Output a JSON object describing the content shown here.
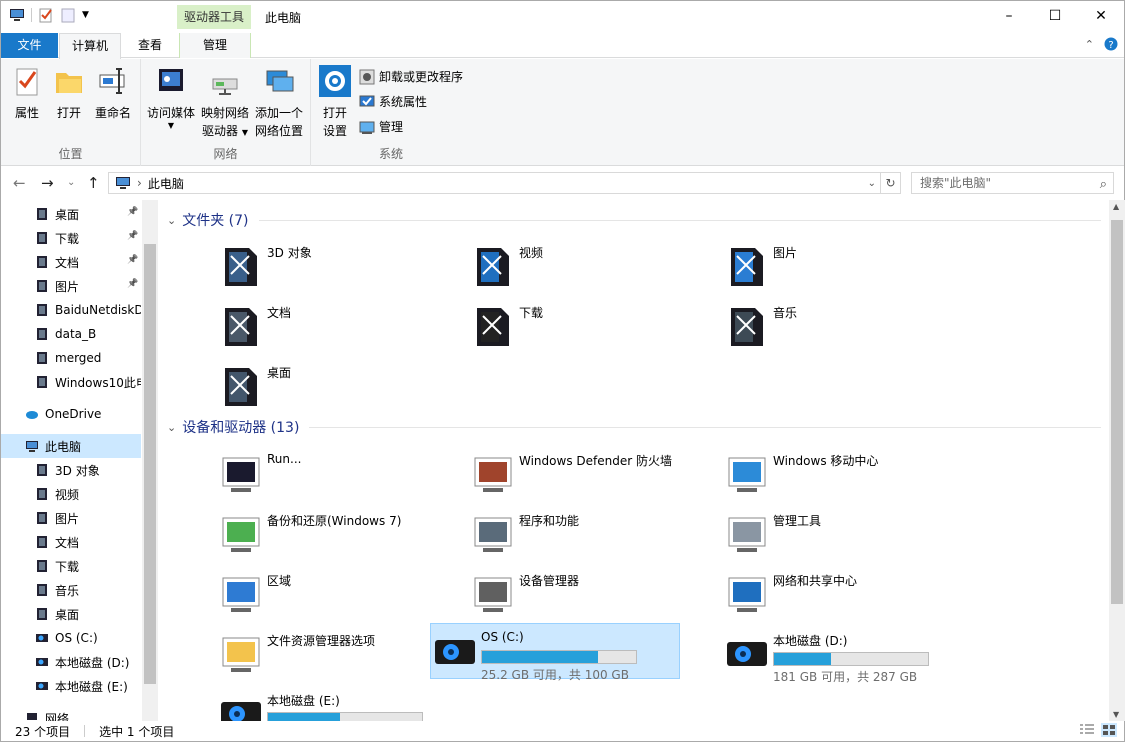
{
  "window": {
    "title": "此电脑",
    "context_tab": "驱动器工具",
    "controls": [
      "–",
      "☐",
      "✕"
    ]
  },
  "tabs": {
    "file": "文件",
    "computer": "计算机",
    "view": "查看",
    "manage": "管理"
  },
  "ribbon": {
    "location": {
      "label": "位置",
      "properties": "属性",
      "open": "打开",
      "rename": "重命名"
    },
    "network": {
      "label": "网络",
      "media": "访问媒体",
      "map_drive_1": "映射网络",
      "map_drive_2": "驱动器",
      "add_loc_1": "添加一个",
      "add_loc_2": "网络位置"
    },
    "system": {
      "label": "系统",
      "open_settings_1": "打开",
      "open_settings_2": "设置",
      "uninstall": "卸载或更改程序",
      "sys_props": "系统属性",
      "manage": "管理"
    }
  },
  "address": {
    "path": "此电脑",
    "search_placeholder": "搜索\"此电脑\""
  },
  "nav": {
    "items": [
      {
        "label": "桌面",
        "pinned": true
      },
      {
        "label": "下载",
        "pinned": true
      },
      {
        "label": "文档",
        "pinned": true
      },
      {
        "label": "图片",
        "pinned": true
      },
      {
        "label": "BaiduNetdiskD"
      },
      {
        "label": "data_B"
      },
      {
        "label": "merged"
      },
      {
        "label": "Windows10此电"
      },
      {
        "label": "OneDrive"
      },
      {
        "label": "此电脑"
      },
      {
        "label": "3D 对象"
      },
      {
        "label": "视频"
      },
      {
        "label": "图片"
      },
      {
        "label": "文档"
      },
      {
        "label": "下载"
      },
      {
        "label": "音乐"
      },
      {
        "label": "桌面"
      },
      {
        "label": "OS (C:)"
      },
      {
        "label": "本地磁盘 (D:)"
      },
      {
        "label": "本地磁盘 (E:)"
      },
      {
        "label": "网络"
      }
    ]
  },
  "folders": {
    "header": "文件夹 (7)",
    "items": [
      "3D 对象",
      "视频",
      "图片",
      "文档",
      "下载",
      "音乐",
      "桌面"
    ]
  },
  "devices": {
    "header": "设备和驱动器 (13)",
    "items": [
      "Run...",
      "Windows Defender 防火墙",
      "Windows 移动中心",
      "备份和还原(Windows 7)",
      "程序和功能",
      "管理工具",
      "区域",
      "设备管理器",
      "网络和共享中心",
      "文件资源管理器选项"
    ],
    "drives": [
      {
        "name": "OS (C:)",
        "caption": "25.2 GB 可用，共 100 GB",
        "used": 0.75
      },
      {
        "name": "本地磁盘 (D:)",
        "caption": "181 GB 可用，共 287 GB",
        "used": 0.37
      },
      {
        "name": "本地磁盘 (E:)",
        "caption": "",
        "used": 0.47
      }
    ]
  },
  "status": {
    "count": "23 个项目",
    "selected": "选中 1 个项目"
  },
  "colors": {
    "accent": "#1979ca",
    "selection": "#cce8ff",
    "bar": "#26a0da",
    "header": "#1e3287"
  }
}
